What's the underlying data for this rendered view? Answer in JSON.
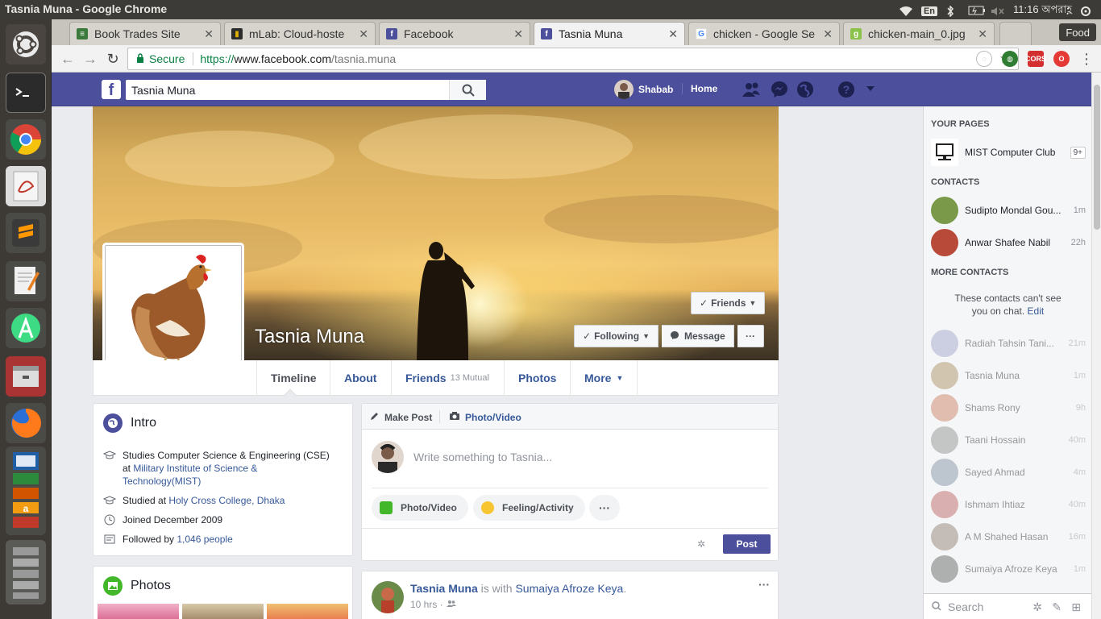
{
  "os": {
    "window_title": "Tasnia Muna - Google Chrome",
    "lang": "En",
    "clock": "11:16 অপরাহ্ণ"
  },
  "browser": {
    "tabs": [
      {
        "label": "Book Trades Site",
        "favicon": "book-icon",
        "color": "#3a7a3a"
      },
      {
        "label": "mLab: Cloud-hoste",
        "favicon": "mlab-icon",
        "color": "#2c2c2c"
      },
      {
        "label": "Facebook",
        "favicon": "facebook-icon",
        "color": "#4b4f9c"
      },
      {
        "label": "Tasnia Muna",
        "favicon": "facebook-icon",
        "color": "#4b4f9c"
      },
      {
        "label": "chicken - Google Se",
        "favicon": "google-icon",
        "color": "#4285f4"
      },
      {
        "label": "chicken-main_0.jpg",
        "favicon": "image-icon",
        "color": "#8bc34a"
      }
    ],
    "profile": "Food",
    "url": {
      "secure_label": "Secure",
      "scheme": "https://",
      "host": "www.facebook.com",
      "path": "/tasnia.muna"
    }
  },
  "fb": {
    "search_value": "Tasnia Muna",
    "user_name": "Shabab",
    "home_label": "Home",
    "profile_name": "Tasnia Muna",
    "friends_btn": "Friends",
    "following_btn": "Following",
    "message_btn": "Message",
    "more_btn": "···",
    "nav": {
      "timeline": "Timeline",
      "about": "About",
      "friends": "Friends",
      "friends_mutual": "13 Mutual",
      "photos": "Photos",
      "more": "More"
    },
    "intro": {
      "title": "Intro",
      "study_prefix": "Studies Computer Science & Engineering (CSE)",
      "study_at": "at ",
      "study_link_1": "Military Institute of Science &",
      "study_link_2": "Technology(MIST)",
      "studied_prefix": "Studied at ",
      "studied_link": "Holy Cross College, Dhaka",
      "joined": "Joined December 2009",
      "followed_prefix": "Followed by ",
      "followed_link": "1,046 people"
    },
    "photos_title": "Photos",
    "composer": {
      "make_post": "Make Post",
      "photo_video_tab": "Photo/Video",
      "placeholder": "Write something to Tasnia...",
      "chip_photo": "Photo/Video",
      "chip_feeling": "Feeling/Activity",
      "chip_more": "···",
      "post_btn": "Post"
    },
    "feed_post": {
      "author": "Tasnia Muna",
      "is_with": " is with ",
      "tagged": "Sumaiya Afroze Keya",
      "period": ".",
      "time": "10 hrs ·",
      "menu": "···"
    }
  },
  "chat": {
    "your_pages_title": "YOUR PAGES",
    "page_name": "MIST Computer Club",
    "page_badge": "9+",
    "contacts_title": "CONTACTS",
    "contacts": [
      {
        "name": "Sudipto Mondal Gou...",
        "time": "1m",
        "color": "#7a9a4a"
      },
      {
        "name": "Anwar Shafee Nabil",
        "time": "22h",
        "color": "#b84a3a"
      }
    ],
    "more_contacts_title": "MORE CONTACTS",
    "more_contacts_note_1": "These contacts can't see",
    "more_contacts_note_2": "you on chat.",
    "more_contacts_edit": "Edit",
    "offline": [
      {
        "name": "Radiah Tahsin Tani...",
        "time": "21m",
        "color": "#9aa0c8"
      },
      {
        "name": "Tasnia Muna",
        "time": "1m",
        "color": "#a98a5a"
      },
      {
        "name": "Shams Rony",
        "time": "9h",
        "color": "#c87a5a"
      },
      {
        "name": "Taani Hossain",
        "time": "40m",
        "color": "#8a8a8a"
      },
      {
        "name": "Sayed Ahmad",
        "time": "4m",
        "color": "#7a8aa0"
      },
      {
        "name": "Ishmam Ihtiaz",
        "time": "40m",
        "color": "#b85a5a"
      },
      {
        "name": "A M Shahed Hasan",
        "time": "16m",
        "color": "#8a7a6a"
      },
      {
        "name": "Sumaiya Afroze Keya",
        "time": "1m",
        "color": "#5a5a5a"
      }
    ],
    "search_placeholder": "Search"
  }
}
